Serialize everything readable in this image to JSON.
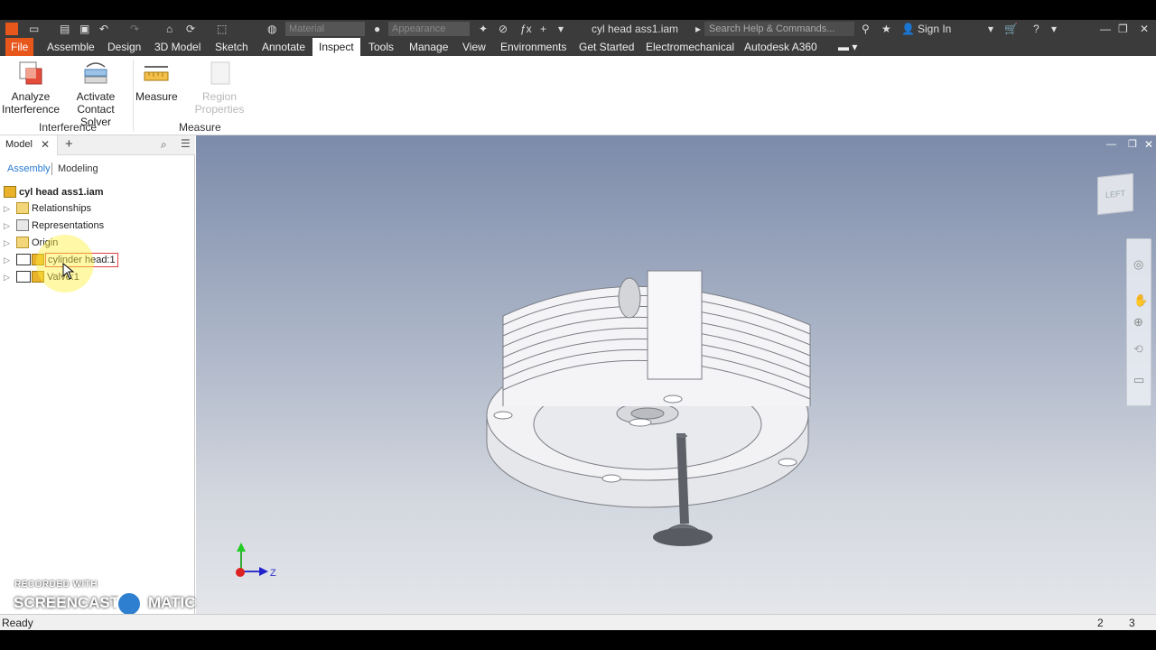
{
  "titlebar": {
    "material_placeholder": "Material",
    "appearance_placeholder": "Appearance",
    "document_title": "cyl head ass1.iam",
    "search_placeholder": "Search Help & Commands...",
    "sign_in": "Sign In"
  },
  "ribbon_tabs": [
    {
      "label": "File"
    },
    {
      "label": "Assemble"
    },
    {
      "label": "Design"
    },
    {
      "label": "3D Model"
    },
    {
      "label": "Sketch"
    },
    {
      "label": "Annotate"
    },
    {
      "label": "Inspect"
    },
    {
      "label": "Tools"
    },
    {
      "label": "Manage"
    },
    {
      "label": "View"
    },
    {
      "label": "Environments"
    },
    {
      "label": "Get Started"
    },
    {
      "label": "Electromechanical"
    },
    {
      "label": "Autodesk A360"
    }
  ],
  "ribbon": {
    "analyze_line1": "Analyze",
    "analyze_line2": "Interference",
    "activate_line1": "Activate",
    "activate_line2": "Contact Solver",
    "measure": "Measure",
    "region_properties": "Region Properties",
    "panel_interference": "Interference",
    "panel_measure": "Measure"
  },
  "browser": {
    "tab_model": "Model",
    "mode_assembly": "Assembly",
    "mode_modeling": "Modeling",
    "tree": [
      {
        "label": "cyl head ass1.iam"
      },
      {
        "label": "Relationships"
      },
      {
        "label": "Representations"
      },
      {
        "label": "Origin"
      },
      {
        "label": "cylinder head:1"
      },
      {
        "label": "Valve:1"
      }
    ]
  },
  "viewcube": {
    "face_label": "LEFT"
  },
  "triad": {
    "z_label": "Z"
  },
  "watermark": {
    "line1": "RECORDED WITH",
    "line2": "SCREENCAST",
    "line3": "MATIC"
  },
  "status": {
    "text": "Ready",
    "num1": "2",
    "num2": "3"
  },
  "colors": {
    "file_tab": "#e7561b",
    "titlebar": "#3b3b3b",
    "accent_blue": "#2a7bd1"
  }
}
